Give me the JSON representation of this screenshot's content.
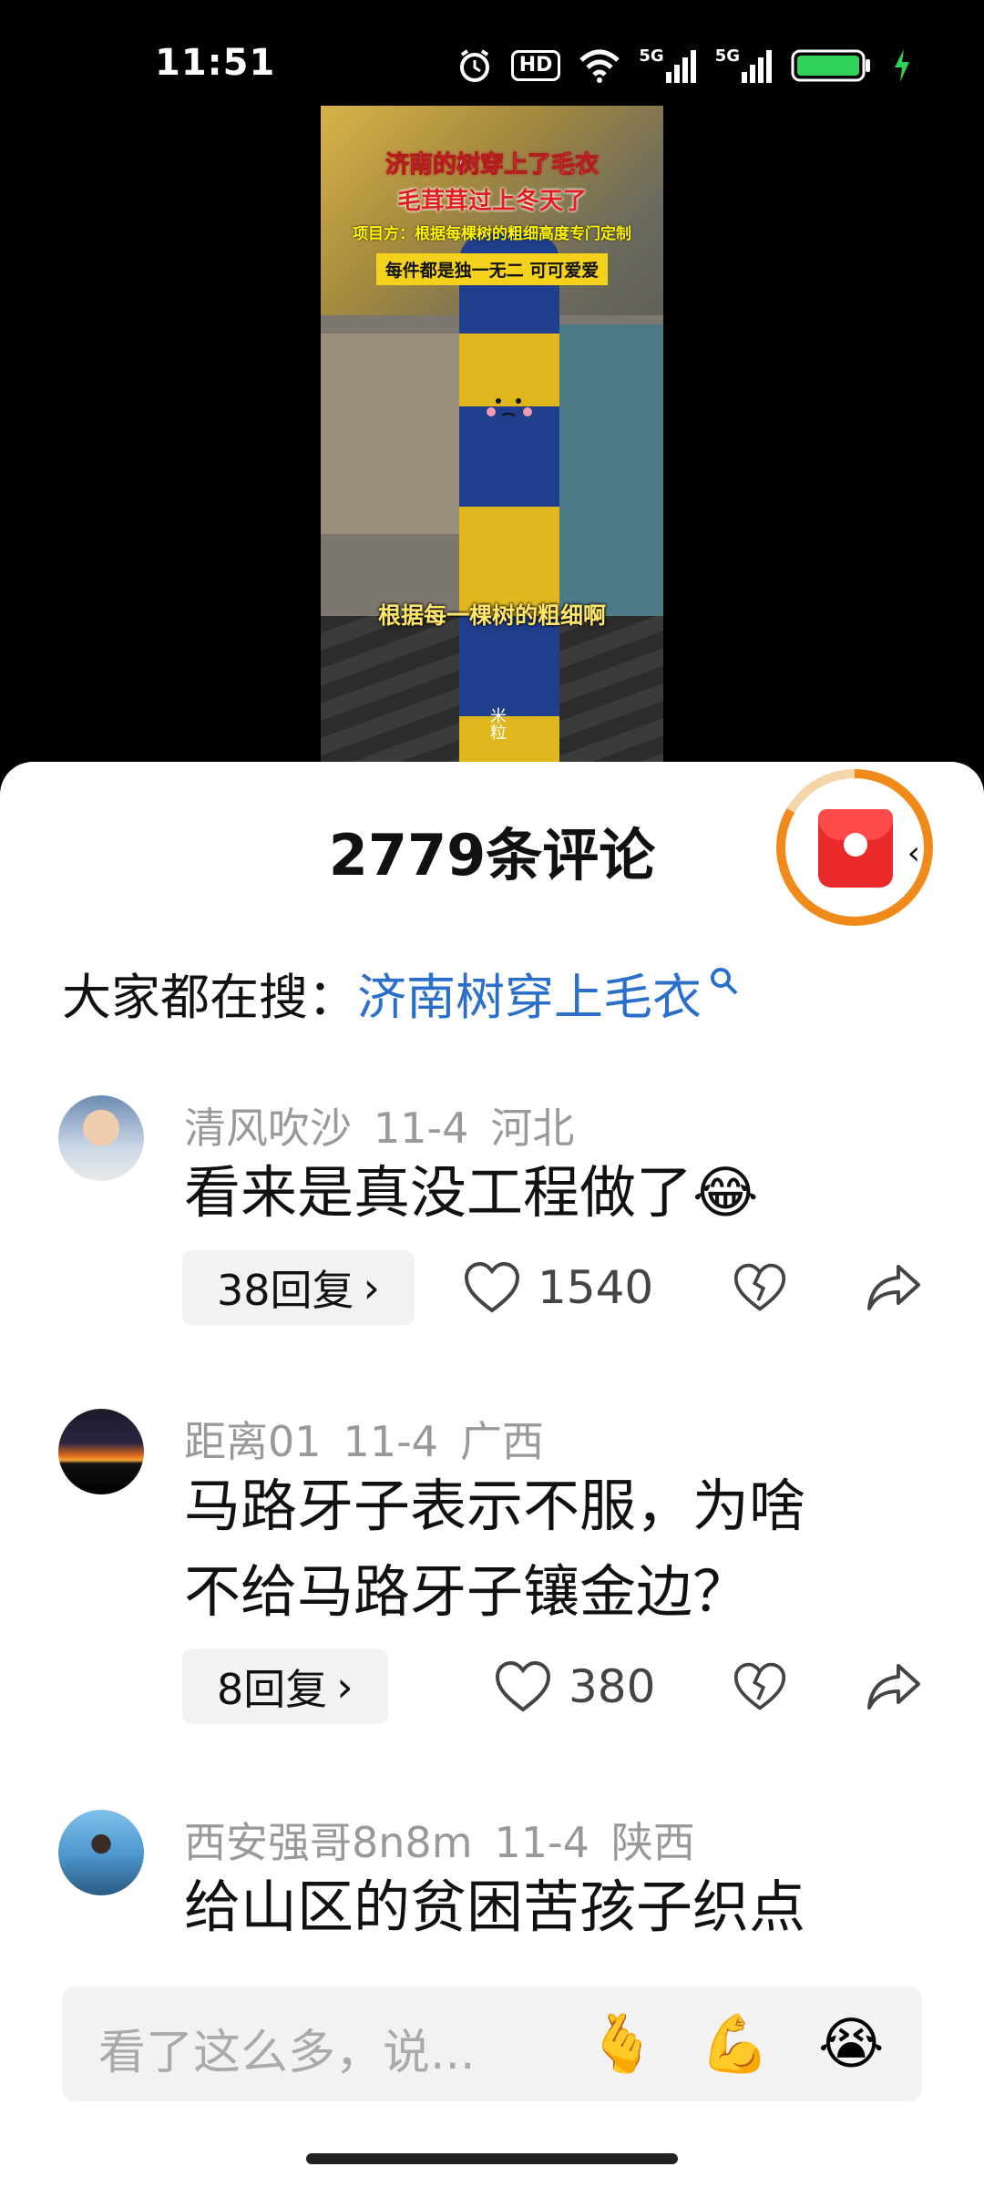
{
  "status_bar": {
    "time": "11:51",
    "hd_label": "HD",
    "network1": "5G",
    "network2": "5G"
  },
  "video": {
    "caption1": "济南的树穿上了毛衣",
    "caption2": "毛茸茸过上冬天了",
    "caption3": "项目方：根据每棵树的粗细高度专门定制",
    "caption4": "每件都是独一无二 可可爱爱",
    "caption5": "根据每一棵树的粗细啊",
    "watermark": "米粒"
  },
  "sheet": {
    "title": "2779条评论",
    "search_prefix": "大家都在搜：",
    "search_link": "济南树穿上毛衣"
  },
  "comments": [
    {
      "user": "清风吹沙",
      "date": "11-4",
      "region": "河北",
      "text_lines": [
        "看来是真没工程做了😂"
      ],
      "reply_label": "38回复",
      "likes": "1540"
    },
    {
      "user": "距离01",
      "date": "11-4",
      "region": "广西",
      "text_lines": [
        "马路牙子表示不服，为啥",
        "不给马路牙子镶金边？"
      ],
      "reply_label": "8回复",
      "likes": "380"
    },
    {
      "user": "西安强哥8n8m",
      "date": "11-4",
      "region": "陕西",
      "text_lines": [
        "给山区的贫困苦孩子织点"
      ]
    }
  ],
  "input_bar": {
    "placeholder": "看了这么多，说...",
    "emoji1": "🫰",
    "emoji2": "💪",
    "emoji3": "😭"
  }
}
